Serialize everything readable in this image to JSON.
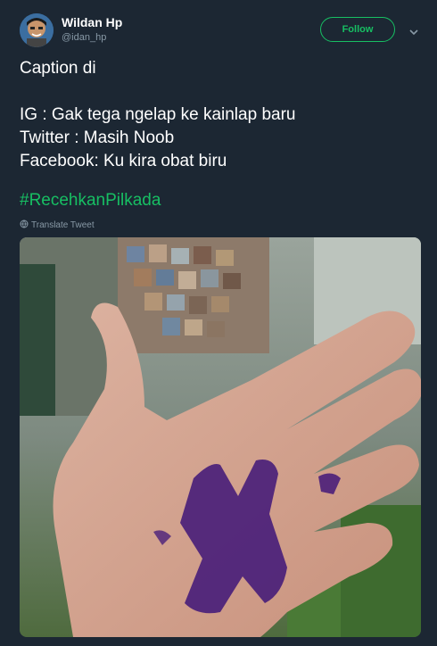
{
  "user": {
    "name": "Wildan Hp",
    "handle": "@idan_hp",
    "follow_label": "Follow"
  },
  "tweet": {
    "lines": "Caption di\n\nIG : Gak tega ngelap ke kainlap baru\nTwitter : Masih Noob\nFacebook: Ku kira obat biru",
    "hashtag": "#RecehkanPilkada",
    "translate_label": "Translate Tweet"
  },
  "colors": {
    "background": "#1c2733",
    "accent": "#17bf63",
    "muted": "#8899a6"
  },
  "icons": [
    "avatar",
    "chevron-down-icon",
    "globe-icon"
  ]
}
